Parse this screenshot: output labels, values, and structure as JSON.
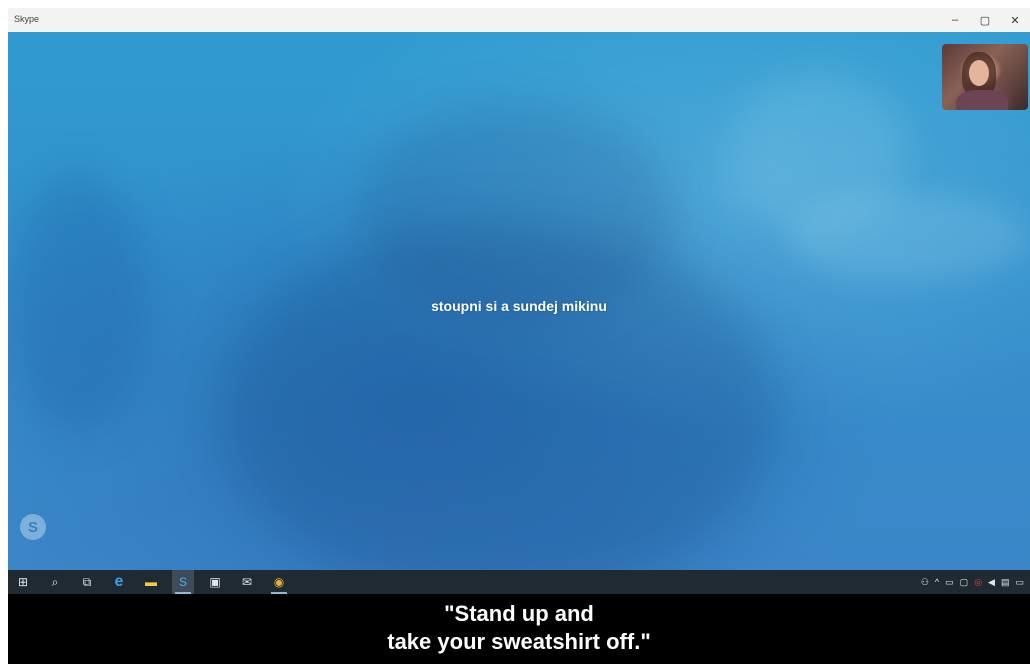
{
  "window": {
    "title": "Skype"
  },
  "window_controls": [
    "–",
    "▢",
    "✕"
  ],
  "call": {
    "message": "stoupni si a sundej mikinu",
    "self_view_label": "self-view-video"
  },
  "taskbar": {
    "left_icons": [
      {
        "name": "windows-start-icon",
        "glyph": "⊞"
      },
      {
        "name": "search-icon",
        "glyph": "⌕"
      },
      {
        "name": "task-view-icon",
        "glyph": "⧉"
      },
      {
        "name": "edge-icon",
        "glyph": "e"
      },
      {
        "name": "file-explorer-icon",
        "glyph": "▬"
      },
      {
        "name": "skype-icon",
        "glyph": "S"
      },
      {
        "name": "store-icon",
        "glyph": "▣"
      },
      {
        "name": "mail-icon",
        "glyph": "✉"
      },
      {
        "name": "chrome-icon",
        "glyph": "◉"
      }
    ],
    "tray_icons": [
      {
        "name": "people-icon",
        "glyph": "⚇"
      },
      {
        "name": "show-hidden-icons-icon",
        "glyph": "^"
      },
      {
        "name": "network-icon",
        "glyph": "▭"
      },
      {
        "name": "monitor-icon",
        "glyph": "▢"
      },
      {
        "name": "skype-tray-icon",
        "glyph": "◎"
      },
      {
        "name": "volume-icon",
        "glyph": "◀"
      },
      {
        "name": "keyboard-icon",
        "glyph": "▤"
      },
      {
        "name": "notifications-icon",
        "glyph": "▭"
      }
    ]
  },
  "subtitle": {
    "line1": "\"Stand up and",
    "line2": "take your sweatshirt off.\""
  },
  "colors": {
    "call_background": "#3490cc",
    "taskbar": "#1f2a33",
    "titlebar": "#f3f3f3"
  }
}
